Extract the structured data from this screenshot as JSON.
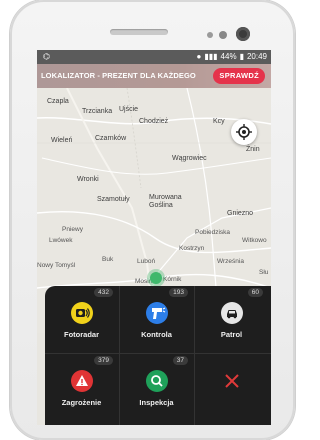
{
  "status": {
    "time": "20:49",
    "battery": "44%"
  },
  "banner": {
    "text": "LOKALIZATOR - PREZENT DLA KAŻDEGO",
    "button": "SPRAWDŹ"
  },
  "map": {
    "towns": [
      "Czapla",
      "Trzcianka",
      "Ujście",
      "Chodzież",
      "Kcy",
      "Wieleń",
      "Czarnków",
      "Żnin",
      "Wągrowiec",
      "Wronki",
      "Szamotuły",
      "Murowana Goślina",
      "Gniezno",
      "Pniewy",
      "Lwówek",
      "Pobiedziska",
      "Witkowo",
      "Kostrzyn",
      "Nowy Tomyśl",
      "Buk",
      "Luboń",
      "Września",
      "Słu",
      "Mosina",
      "Kórnik"
    ]
  },
  "menu": {
    "tiles": [
      {
        "label": "Fotoradar",
        "count": "432",
        "color": "#f1d21b"
      },
      {
        "label": "Kontrola",
        "count": "193",
        "color": "#2d7ee8"
      },
      {
        "label": "Patrol",
        "count": "60",
        "color": "#e6e6e6"
      },
      {
        "label": "Zagrożenie",
        "count": "379",
        "color": "#e03435"
      },
      {
        "label": "Inspekcja",
        "count": "37",
        "color": "#1fa15a"
      },
      {
        "label": "",
        "count": "",
        "color": "#e03a3a"
      }
    ]
  }
}
